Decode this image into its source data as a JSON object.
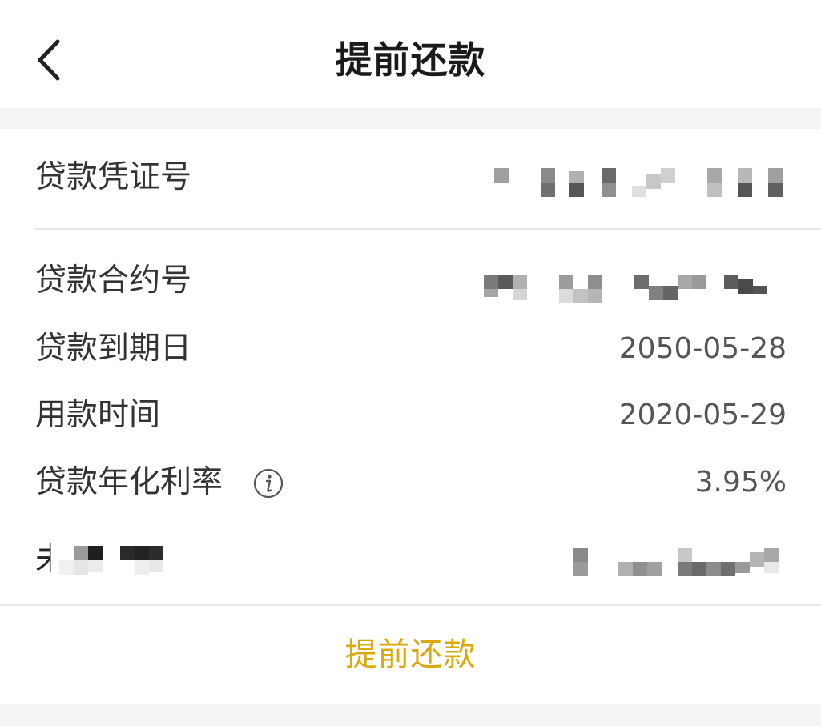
{
  "header": {
    "title": "提前还款",
    "back_icon": "chevron-left-icon"
  },
  "loan_details": {
    "voucher": {
      "label": "贷款凭证号",
      "value_redacted": true
    },
    "contract": {
      "label": "贷款合约号",
      "value_redacted": true
    },
    "due_date": {
      "label": "贷款到期日",
      "value": "2050-05-28"
    },
    "use_time": {
      "label": "用款时间",
      "value": "2020-05-29"
    },
    "annual_rate": {
      "label": "贷款年化利率",
      "value": "3.95%",
      "info_icon": "info-icon"
    },
    "redacted_row": {
      "label_visible_prefix": "未",
      "value_redacted": true
    }
  },
  "actions": {
    "prepay_label": "提前还款"
  },
  "colors": {
    "accent": "#d9a90e",
    "label_text": "#333333",
    "value_text": "#555555",
    "band": "#f4f4f4"
  }
}
